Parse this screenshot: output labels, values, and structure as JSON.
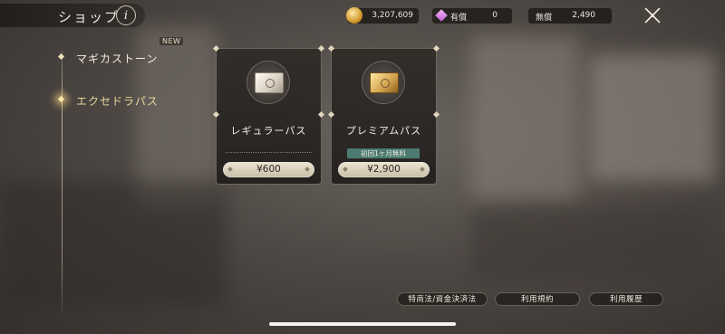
{
  "header": {
    "title": "ショップ",
    "info_label": "i",
    "currencies": {
      "coin": {
        "icon": "gold-coin-icon",
        "value": "3,207,609"
      },
      "paid": {
        "icon": "pink-gem-icon",
        "label": "有償",
        "value": "0"
      },
      "free": {
        "label": "無償",
        "value": "2,490"
      }
    },
    "close_icon": "close-icon"
  },
  "sidebar": {
    "items": [
      {
        "label": "マギカストーン",
        "badge": "NEW",
        "active": false
      },
      {
        "label": "エクセドラパス",
        "active": true
      }
    ]
  },
  "cards": [
    {
      "name": "レギュラーパス",
      "price": "¥600",
      "ticket": "silver"
    },
    {
      "name": "プレミアムパス",
      "badge": "初回1ヶ月無料",
      "price": "¥2,900",
      "ticket": "gold"
    }
  ],
  "footer": {
    "links": [
      "特商法/資金決済法",
      "利用規約",
      "利用履歴"
    ]
  },
  "colors": {
    "accent_gold": "#e8d69a",
    "badge_green": "#4c7a70",
    "price_button": "#ece4d2"
  }
}
